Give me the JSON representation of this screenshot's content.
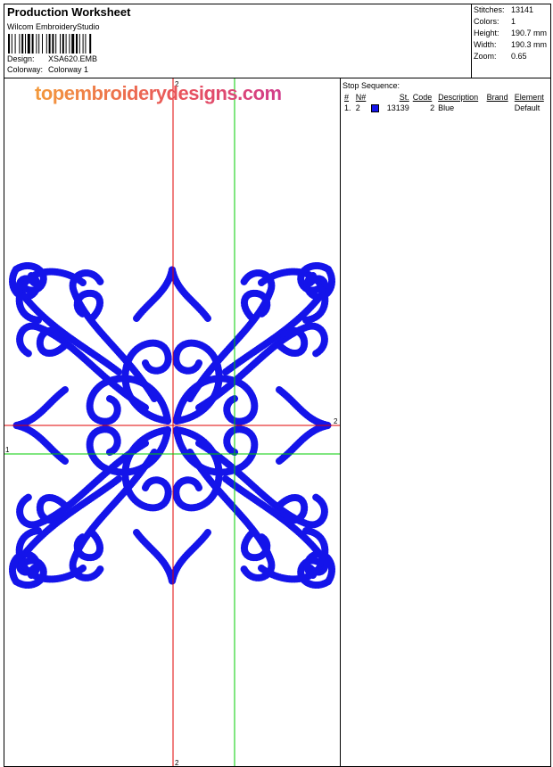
{
  "header": {
    "title": "Production Worksheet",
    "app_name": "Wilcom  EmbroideryStudio",
    "design_label": "Design:",
    "design_value": "XSA620.EMB",
    "colorway_label": "Colorway:",
    "colorway_value": "Colorway 1"
  },
  "stats": {
    "stitches_label": "Stitches:",
    "stitches_value": "13141",
    "colors_label": "Colors:",
    "colors_value": "1",
    "height_label": "Height:",
    "height_value": "190.7 mm",
    "width_label": "Width:",
    "width_value": "190.3 mm",
    "zoom_label": "Zoom:",
    "zoom_value": "0.65"
  },
  "watermark": "topembroiderydesigns.com",
  "markers": {
    "v1": "2",
    "v2": "2",
    "h1": "2",
    "h2": "1"
  },
  "stop_sequence": {
    "title": "Stop Sequence:",
    "headers": [
      "#",
      "N#",
      "St.",
      "Code",
      "Description",
      "Brand",
      "Element"
    ],
    "rows": [
      {
        "index": "1.",
        "needle": "2",
        "stitches": "13139",
        "code": "2",
        "description": "Blue",
        "brand": "",
        "element": "Default"
      }
    ]
  },
  "colors": {
    "thread": "#1414ea",
    "red_axis": "#e00000",
    "green_axis": "#00cc00"
  }
}
